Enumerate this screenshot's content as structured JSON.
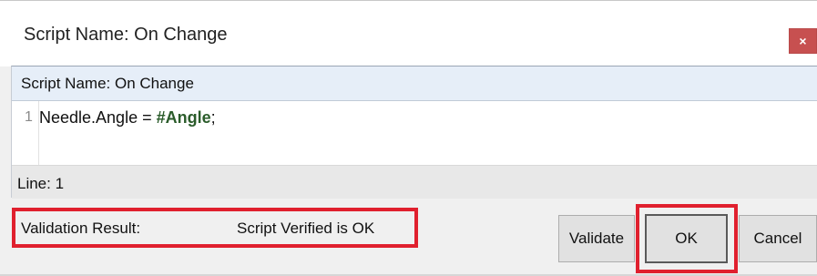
{
  "dialog": {
    "title": "Script Name: On Change",
    "close_label": "×"
  },
  "editor": {
    "header": "Script Name: On Change",
    "line_number": "1",
    "code": {
      "object": "Needle.Angle",
      "operator": " = ",
      "parameter": "#Angle",
      "terminator": ";"
    },
    "status": "Line: 1"
  },
  "validation": {
    "label": "Validation Result:",
    "value": "Script Verified is OK"
  },
  "buttons": {
    "validate": "Validate",
    "ok": "OK",
    "cancel": "Cancel"
  },
  "colors": {
    "highlight": "#e0202e",
    "close_button": "#c75050",
    "header_bg": "#e6eef8"
  }
}
